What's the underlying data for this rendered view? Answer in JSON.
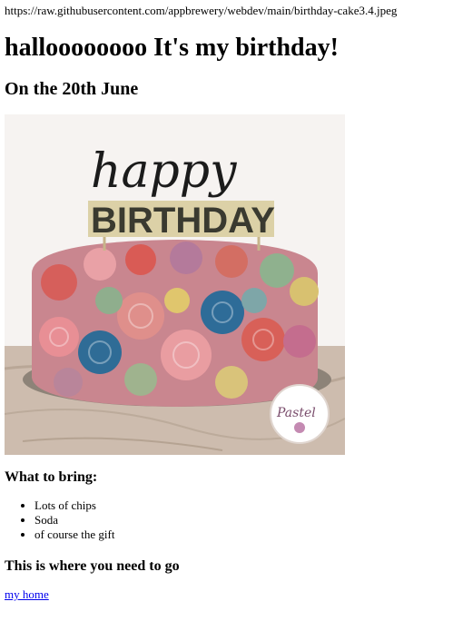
{
  "url_text": "https://raw.githubusercontent.com/appbrewery/webdev/main/birthday-cake3.4.jpeg",
  "title": "halloooooooo It's my birthday!",
  "date_heading": "On the 20th June",
  "cake_image": {
    "topper_text_top": "happy",
    "topper_text_bottom": "BIRTHDAY",
    "badge_text": "Pastel",
    "colors": {
      "wall": "#f3f0ee",
      "table": "#c9b7a8",
      "pink": "#e88a8f",
      "coral": "#d85b55",
      "blue": "#2e6f9a",
      "mauve": "#b87a9c",
      "green": "#8fb38a",
      "yellow": "#e2c56b",
      "gold": "#c7b58a"
    }
  },
  "bring_section": {
    "heading": "What to bring:",
    "items": [
      "Lots of chips",
      "Soda",
      "of course the gift"
    ]
  },
  "where_section": {
    "heading": "This is where you need to go",
    "link_label": "my home"
  }
}
